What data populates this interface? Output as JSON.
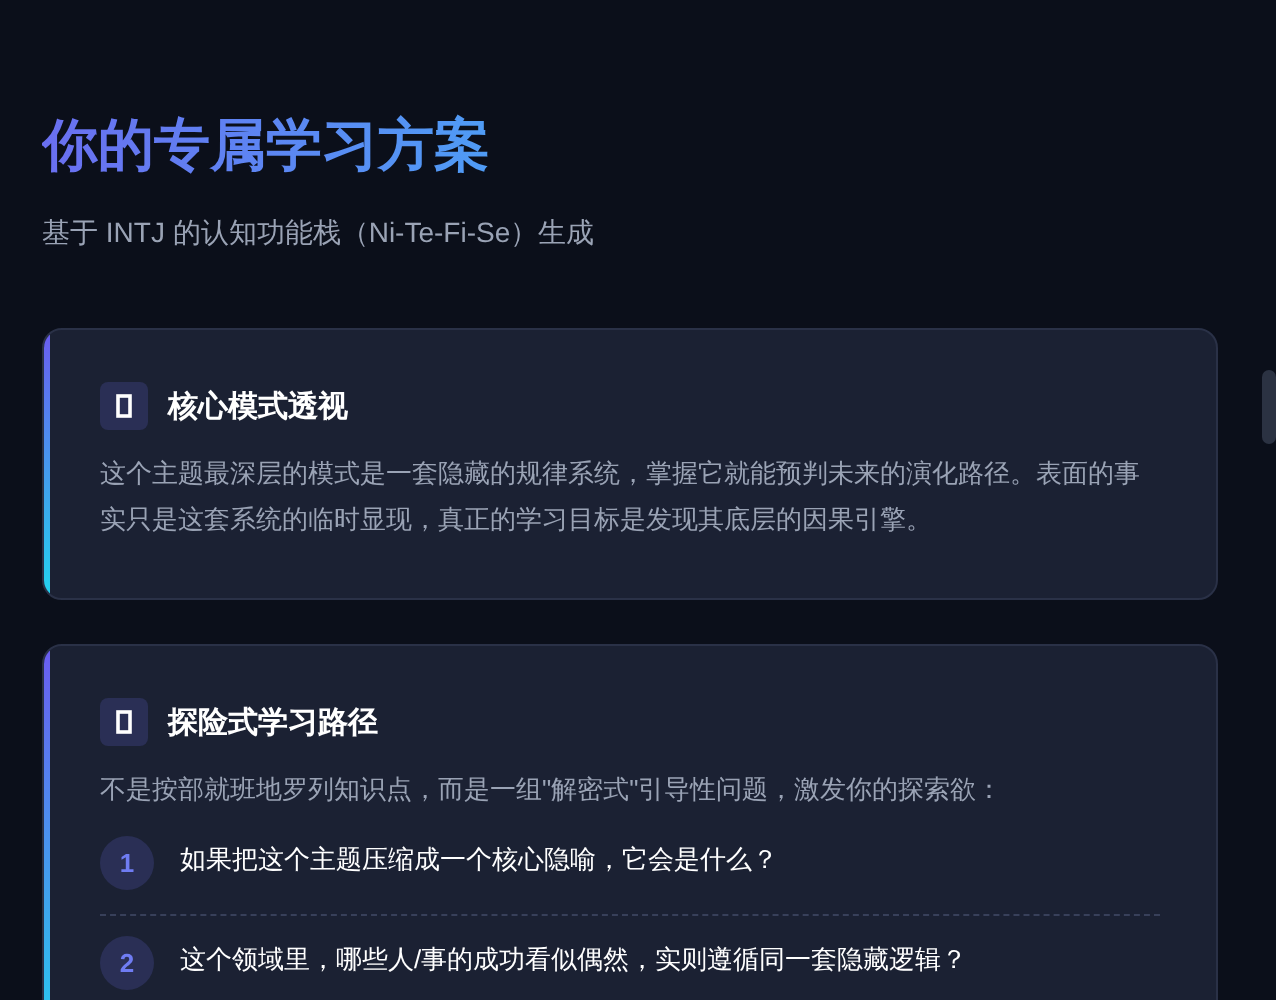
{
  "header": {
    "title": "你的专属学习方案",
    "subtitle": "基于 INTJ 的认知功能栈（Ni-Te-Fi-Se）生成"
  },
  "cards": [
    {
      "title": "核心模式透视",
      "body": "这个主题最深层的模式是一套隐藏的规律系统，掌握它就能预判未来的演化路径。表面的事实只是这套系统的临时显现，真正的学习目标是发现其底层的因果引擎。"
    },
    {
      "title": "探险式学习路径",
      "body": "不是按部就班地罗列知识点，而是一组\"解密式\"引导性问题，激发你的探索欲：",
      "steps": [
        {
          "number": "1",
          "text": "如果把这个主题压缩成一个核心隐喻，它会是什么？"
        },
        {
          "number": "2",
          "text": "这个领域里，哪些人/事的成功看似偶然，实则遵循同一套隐藏逻辑？"
        }
      ]
    }
  ]
}
